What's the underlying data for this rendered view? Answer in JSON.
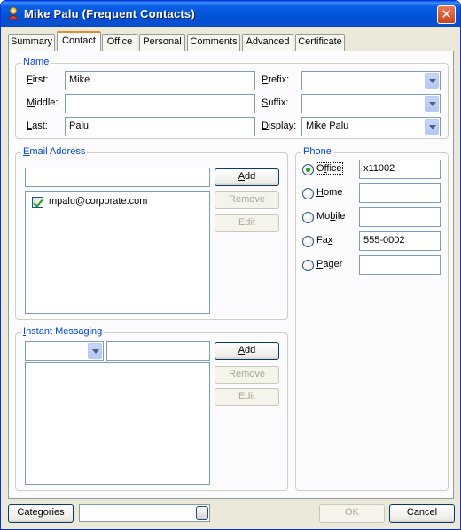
{
  "window": {
    "title": "Mike Palu (Frequent Contacts)",
    "icon": "contact-person-icon",
    "close_glyph": "✕"
  },
  "tabs": [
    "Summary",
    "Contact",
    "Office",
    "Personal",
    "Comments",
    "Advanced",
    "Certificate"
  ],
  "active_tab": "Contact",
  "name_group": {
    "label": "Name",
    "first": {
      "label_u": "F",
      "label_rest": "irst:",
      "value": "Mike"
    },
    "middle": {
      "label_u": "M",
      "label_rest": "iddle:",
      "value": ""
    },
    "last": {
      "label_u": "L",
      "label_rest": "ast:",
      "value": "Palu"
    },
    "prefix": {
      "label_u": "P",
      "label_rest": "refix:",
      "value": ""
    },
    "suffix": {
      "label_u": "S",
      "label_rest": "uffix:",
      "value": ""
    },
    "display": {
      "label_u": "D",
      "label_rest": "isplay:",
      "value": "Mike Palu"
    }
  },
  "email_group": {
    "label_u": "E",
    "label_rest": "mail Address",
    "input_value": "",
    "add_u": "A",
    "add_rest": "dd",
    "remove_label": "Remove",
    "edit_label": "Edit",
    "items": [
      {
        "address": "mpalu@corporate.com",
        "checked": true
      }
    ]
  },
  "phone_group": {
    "label": "Phone",
    "rows": [
      {
        "label_pre": "O",
        "label_u": "f",
        "label_rest": "fice",
        "value": "x11002",
        "selected": true
      },
      {
        "label_pre": "",
        "label_u": "H",
        "label_rest": "ome",
        "value": "",
        "selected": false
      },
      {
        "label_pre": "Mo",
        "label_u": "b",
        "label_rest": "ile",
        "value": "",
        "selected": false
      },
      {
        "label_pre": "Fa",
        "label_u": "x",
        "label_rest": "",
        "value": "555-0002",
        "selected": false
      },
      {
        "label_pre": "",
        "label_u": "P",
        "label_rest": "ager",
        "value": "",
        "selected": false
      }
    ]
  },
  "im_group": {
    "label_u": "I",
    "label_rest": "nstant Messaging",
    "service_value": "",
    "input_value": "",
    "add_u": "A",
    "add_rest": "dd",
    "remove_label": "Remove",
    "edit_label": "Edit"
  },
  "footer": {
    "categories_label": "Categories",
    "categories_value": "",
    "ok_label": "OK",
    "cancel_label": "Cancel"
  },
  "colors": {
    "title_bar": "#0a5fe6",
    "group_label": "#0046d5",
    "active_tab_accent": "#e68b2c",
    "radio_dot": "#21a121"
  }
}
